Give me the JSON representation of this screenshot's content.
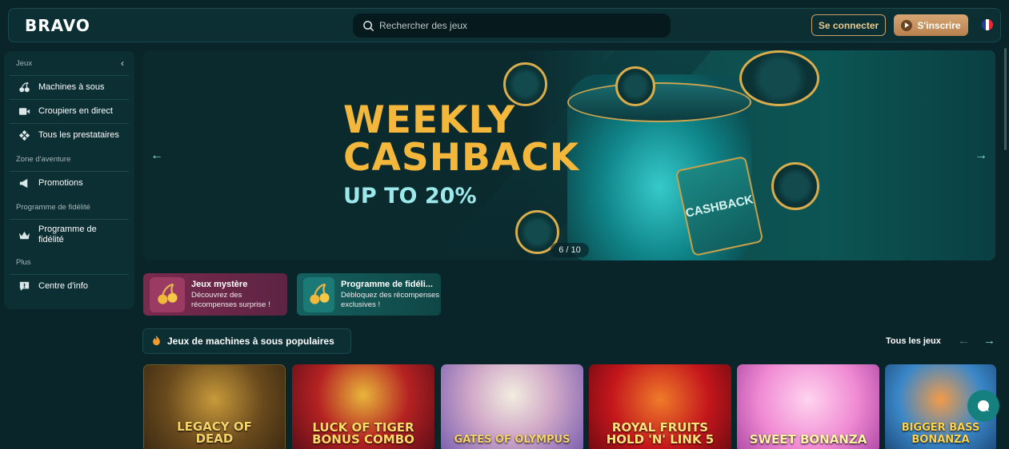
{
  "header": {
    "logo": "BRAVO",
    "search_placeholder": "Rechercher des jeux",
    "login_label": "Se connecter",
    "signup_label": "S'inscrire",
    "language_flag": "flag-fr-icon"
  },
  "sidebar": {
    "sections": [
      {
        "title": "Jeux",
        "items": [
          {
            "label": "Machines à sous",
            "icon": "cherries-icon"
          },
          {
            "label": "Croupiers en direct",
            "icon": "video-icon"
          },
          {
            "label": "Tous les prestataires",
            "icon": "providers-icon"
          }
        ]
      },
      {
        "title": "Zone d'aventure",
        "items": [
          {
            "label": "Promotions",
            "icon": "megaphone-icon"
          }
        ]
      },
      {
        "title": "Programme de fidélité",
        "items": [
          {
            "label": "Programme de fidélité",
            "icon": "crown-icon"
          }
        ]
      },
      {
        "title": "Plus",
        "items": [
          {
            "label": "Centre d'info",
            "icon": "info-icon"
          }
        ]
      }
    ]
  },
  "banner": {
    "title_line1": "WEEKLY",
    "title_line2": "CASHBACK",
    "subtitle": "UP TO 20%",
    "tag_text": "CASHBACK",
    "counter": "6 / 10",
    "colors": {
      "title": "#f3b73c",
      "subtitle": "#9ce8ea"
    }
  },
  "promos": [
    {
      "title": "Jeux mystère",
      "desc": "Découvrez des récompenses surprise !",
      "color": "#7a2a4d"
    },
    {
      "title": "Programme de fidéli...",
      "desc": "Débloquez des récompenses exclusives !",
      "color": "#15615f"
    }
  ],
  "popular": {
    "title": "Jeux de machines à sous populaires",
    "all_label": "Tous les jeux",
    "games": [
      {
        "name": "LEGACY OF DEAD"
      },
      {
        "name": "LUCK OF TIGER BONUS COMBO"
      },
      {
        "name": "GATES OF OLYMPUS"
      },
      {
        "name": "ROYAL FRUITS HOLD 'N' LINK 5"
      },
      {
        "name": "SWEET BONANZA"
      },
      {
        "name": "BIGGER BASS BONANZA"
      }
    ]
  }
}
